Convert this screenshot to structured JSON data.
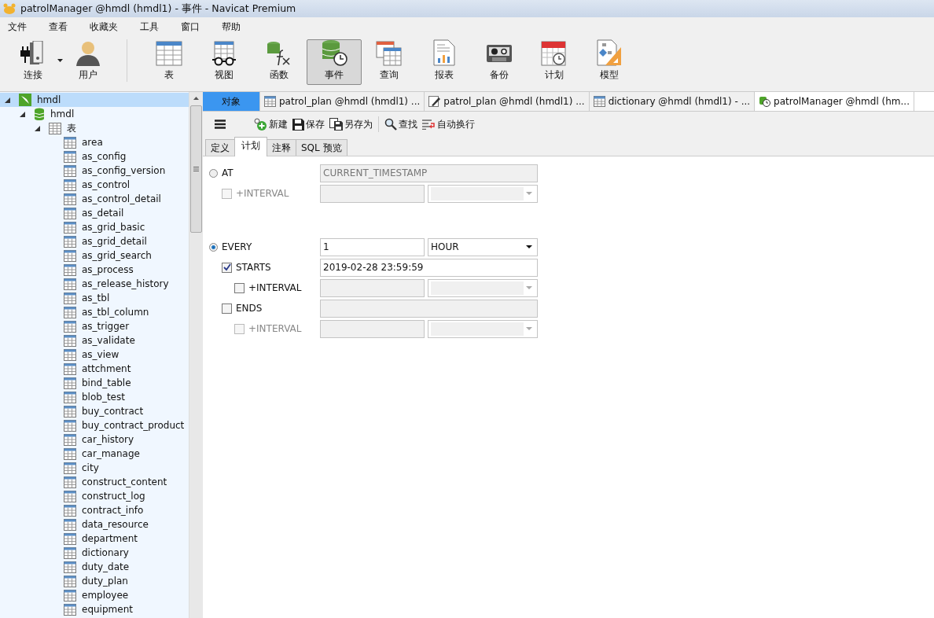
{
  "window": {
    "title": "patrolManager @hmdl (hmdl1) - 事件 - Navicat Premium"
  },
  "menu": [
    "文件",
    "查看",
    "收藏夹",
    "工具",
    "窗口",
    "帮助"
  ],
  "toolbar": [
    {
      "label": "连接",
      "kind": "connect",
      "selected": false,
      "dropdown": true
    },
    {
      "label": "用户",
      "kind": "user",
      "selected": false
    },
    {
      "label": "表",
      "kind": "table",
      "selected": false
    },
    {
      "label": "视图",
      "kind": "view",
      "selected": false
    },
    {
      "label": "函数",
      "kind": "function",
      "selected": false
    },
    {
      "label": "事件",
      "kind": "event",
      "selected": true
    },
    {
      "label": "查询",
      "kind": "query",
      "selected": false
    },
    {
      "label": "报表",
      "kind": "report",
      "selected": false
    },
    {
      "label": "备份",
      "kind": "backup",
      "selected": false
    },
    {
      "label": "计划",
      "kind": "schedule",
      "selected": false
    },
    {
      "label": "模型",
      "kind": "model",
      "selected": false
    }
  ],
  "tabs": [
    {
      "label": "对象",
      "kind": "objects",
      "selected": false
    },
    {
      "label": "patrol_plan @hmdl (hmdl1) ...",
      "kind": "table",
      "selected": false
    },
    {
      "label": "patrol_plan @hmdl (hmdl1) ...",
      "kind": "design",
      "selected": false
    },
    {
      "label": "dictionary @hmdl (hmdl1) - ...",
      "kind": "table",
      "selected": false
    },
    {
      "label": "patrolManager @hmdl (hm...",
      "kind": "event",
      "selected": true
    }
  ],
  "editor_toolbar": [
    {
      "kind": "menu"
    },
    {
      "label": "新建",
      "kind": "new"
    },
    {
      "label": "保存",
      "kind": "save"
    },
    {
      "label": "另存为",
      "kind": "saveas"
    },
    {
      "label": "查找",
      "kind": "find"
    },
    {
      "label": "自动换行",
      "kind": "wrap"
    }
  ],
  "sub_tabs": [
    {
      "label": "定义",
      "selected": false
    },
    {
      "label": "计划",
      "selected": true
    },
    {
      "label": "注释",
      "selected": false
    },
    {
      "label": "SQL 预览",
      "selected": false
    }
  ],
  "schedule": {
    "at": {
      "label": "AT",
      "selected": false,
      "value": "CURRENT_TIMESTAMP",
      "interval": {
        "label": "+INTERVAL",
        "checked": false,
        "disabled": true
      }
    },
    "every": {
      "label": "EVERY",
      "selected": true,
      "value": "1",
      "unit": "HOUR"
    },
    "starts": {
      "label": "STARTS",
      "checked": true,
      "value": "2019-02-28 23:59:59",
      "interval": {
        "label": "+INTERVAL",
        "checked": false,
        "disabled": false
      }
    },
    "ends": {
      "label": "ENDS",
      "checked": false,
      "interval": {
        "label": "+INTERVAL",
        "checked": false,
        "disabled": true
      }
    }
  },
  "tree": [
    {
      "label": "hmdl",
      "kind": "connection",
      "expanded": true,
      "selected": true,
      "children": [
        {
          "label": "hmdl",
          "kind": "database",
          "expanded": true,
          "selected": false,
          "children": [
            {
              "label": "表",
              "kind": "folder",
              "expanded": true,
              "selected": false,
              "children": [
                {
                  "label": "area",
                  "kind": "table",
                  "selected": false
                },
                {
                  "label": "as_config",
                  "kind": "table",
                  "selected": false
                },
                {
                  "label": "as_config_version",
                  "kind": "table",
                  "selected": false
                },
                {
                  "label": "as_control",
                  "kind": "table",
                  "selected": false
                },
                {
                  "label": "as_control_detail",
                  "kind": "table",
                  "selected": false
                },
                {
                  "label": "as_detail",
                  "kind": "table",
                  "selected": false
                },
                {
                  "label": "as_grid_basic",
                  "kind": "table",
                  "selected": false
                },
                {
                  "label": "as_grid_detail",
                  "kind": "table",
                  "selected": false
                },
                {
                  "label": "as_grid_search",
                  "kind": "table",
                  "selected": false
                },
                {
                  "label": "as_process",
                  "kind": "table",
                  "selected": false
                },
                {
                  "label": "as_release_history",
                  "kind": "table",
                  "selected": false
                },
                {
                  "label": "as_tbl",
                  "kind": "table",
                  "selected": false
                },
                {
                  "label": "as_tbl_column",
                  "kind": "table",
                  "selected": false
                },
                {
                  "label": "as_trigger",
                  "kind": "table",
                  "selected": false
                },
                {
                  "label": "as_validate",
                  "kind": "table",
                  "selected": false
                },
                {
                  "label": "as_view",
                  "kind": "table",
                  "selected": false
                },
                {
                  "label": "attchment",
                  "kind": "table",
                  "selected": false
                },
                {
                  "label": "bind_table",
                  "kind": "table",
                  "selected": false
                },
                {
                  "label": "blob_test",
                  "kind": "table",
                  "selected": false
                },
                {
                  "label": "buy_contract",
                  "kind": "table",
                  "selected": false
                },
                {
                  "label": "buy_contract_product",
                  "kind": "table",
                  "selected": false
                },
                {
                  "label": "car_history",
                  "kind": "table",
                  "selected": false
                },
                {
                  "label": "car_manage",
                  "kind": "table",
                  "selected": false
                },
                {
                  "label": "city",
                  "kind": "table",
                  "selected": false
                },
                {
                  "label": "construct_content",
                  "kind": "table",
                  "selected": false
                },
                {
                  "label": "construct_log",
                  "kind": "table",
                  "selected": false
                },
                {
                  "label": "contract_info",
                  "kind": "table",
                  "selected": false
                },
                {
                  "label": "data_resource",
                  "kind": "table",
                  "selected": false
                },
                {
                  "label": "department",
                  "kind": "table",
                  "selected": false
                },
                {
                  "label": "dictionary",
                  "kind": "table",
                  "selected": false
                },
                {
                  "label": "duty_date",
                  "kind": "table",
                  "selected": false
                },
                {
                  "label": "duty_plan",
                  "kind": "table",
                  "selected": false
                },
                {
                  "label": "employee",
                  "kind": "table",
                  "selected": false
                },
                {
                  "label": "equipment",
                  "kind": "table",
                  "selected": false
                }
              ]
            }
          ]
        }
      ]
    }
  ]
}
